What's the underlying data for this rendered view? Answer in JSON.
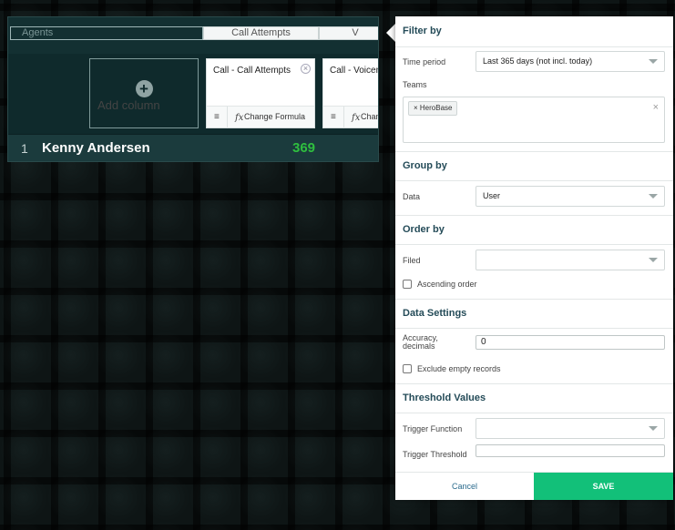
{
  "widget": {
    "header": {
      "agents_placeholder": "Agents",
      "col1": "Call Attempts",
      "col2": "V"
    },
    "add_column_label": "Add column",
    "columns": [
      {
        "title": "Call - Call Attempts",
        "formula_label": "Change Formula"
      },
      {
        "title": "Call - Voicem",
        "formula_label": "Chan"
      }
    ],
    "rows": [
      {
        "rank": "1",
        "name": "Kenny Andersen",
        "value": "369"
      }
    ],
    "value_color": "#2fbf3f"
  },
  "panel": {
    "filter_by": {
      "title": "Filter by",
      "time_period_label": "Time period",
      "time_period_value": "Last 365 days (not incl. today)",
      "teams_label": "Teams",
      "teams": [
        "HeroBase"
      ]
    },
    "group_by": {
      "title": "Group by",
      "data_label": "Data",
      "data_value": "User"
    },
    "order_by": {
      "title": "Order by",
      "field_label": "Filed",
      "field_value": "",
      "ascending_label": "Ascending order"
    },
    "data_settings": {
      "title": "Data Settings",
      "accuracy_label_line1": "Accuracy,",
      "accuracy_label_line2": "decimals",
      "accuracy_value": "0",
      "exclude_label": "Exclude empty records"
    },
    "threshold": {
      "title": "Threshold Values",
      "trigger_function_label": "Trigger Function",
      "trigger_function_value": "",
      "trigger_threshold_label": "Trigger Threshold",
      "trigger_threshold_value": ""
    },
    "footer": {
      "cancel_label": "Cancel",
      "save_label": "SAVE"
    },
    "accent_color": "#12c079",
    "title_color": "#244b58"
  }
}
